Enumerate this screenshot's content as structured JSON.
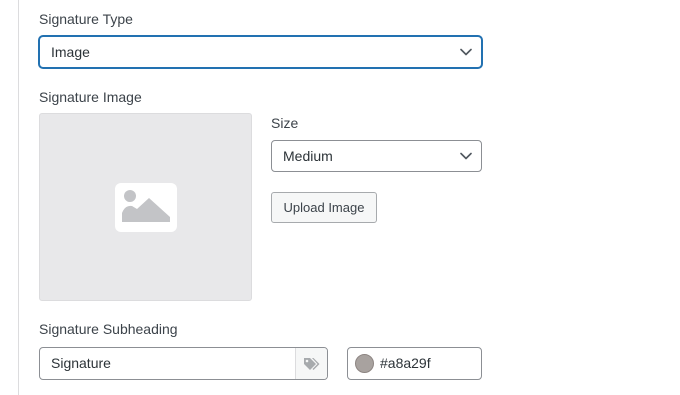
{
  "form": {
    "signature_type": {
      "label": "Signature Type",
      "selected": "Image",
      "chevron_icon": "chevron-down-icon"
    },
    "signature_image": {
      "label": "Signature Image",
      "placeholder_icon": "image-placeholder-icon"
    },
    "size": {
      "label": "Size",
      "selected": "Medium",
      "chevron_icon": "chevron-down-icon"
    },
    "upload_button": {
      "label": "Upload Image"
    },
    "signature_subheading": {
      "label": "Signature Subheading",
      "value": "Signature",
      "tag_icon": "tags-icon"
    },
    "color": {
      "value": "#a8a29f",
      "swatch": "#a8a29f"
    }
  },
  "colors": {
    "focus_border": "#2271b1",
    "input_border": "#8c8f94",
    "placeholder_bg": "#e8e8ea",
    "button_bg": "#f6f7f7"
  }
}
